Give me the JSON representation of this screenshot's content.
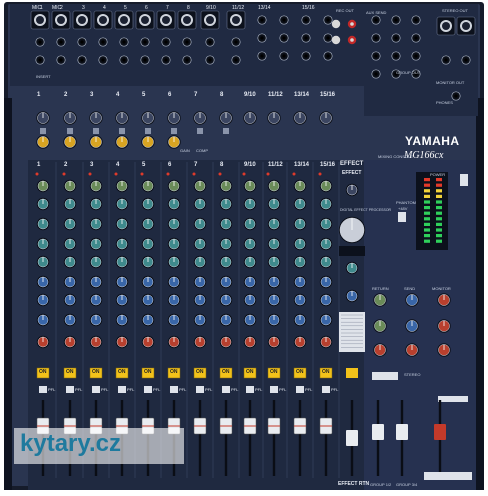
{
  "brand": "YAMAHA",
  "model": "MG166cx",
  "model_desc": "MIXING CONSOLE",
  "input_channel_labels": [
    "1",
    "2",
    "3",
    "4",
    "5",
    "6",
    "7",
    "8",
    "9/10",
    "11/12",
    "13/14",
    "15/16"
  ],
  "top_jack_labels": [
    "MIC",
    "1",
    "MIC",
    "2",
    "3",
    "4",
    "5",
    "6",
    "7",
    "8",
    "9/10",
    "11/12",
    "13/14",
    "15/16"
  ],
  "effect_label": "EFFECT",
  "effect_rtn_label": "EFFECT RTN",
  "digital_effect_label": "DIGITAL EFFECT PROCESSOR",
  "phantom_label": "PHANTOM",
  "phantom_voltage": "+48V",
  "power_label": "POWER",
  "on_label": "ON",
  "pfl_label": "PFL",
  "stereo_label": "STEREO",
  "group_labels": [
    "GROUP 1/2",
    "GROUP 3/4"
  ],
  "stereo_out_label": "STEREO OUT",
  "group_out_label": "GROUP OUT",
  "monitor_out_label": "MONITOR OUT",
  "phones_label": "PHONES",
  "rec_out_label": "REC OUT",
  "aux_send_label": "AUX SEND",
  "return_label": "RETURN",
  "send_label": "SEND",
  "monitor_label": "MONITOR",
  "insert_label": "INSERT",
  "gain_label": "GAIN",
  "comp_label": "COMP",
  "watermark": "kytary.cz",
  "colors": {
    "body": "#2a3550",
    "frame": "#161c2b",
    "strip": "#1f2940",
    "accent_yellow": "#f2c21a",
    "knob_teal": "#3f8a8c",
    "knob_blue": "#3966a8",
    "knob_red": "#b8402e",
    "knob_gold": "#d8a422",
    "meter_green": "#2fd05b",
    "meter_yellow": "#f1d23a",
    "meter_red": "#e23a2a"
  }
}
